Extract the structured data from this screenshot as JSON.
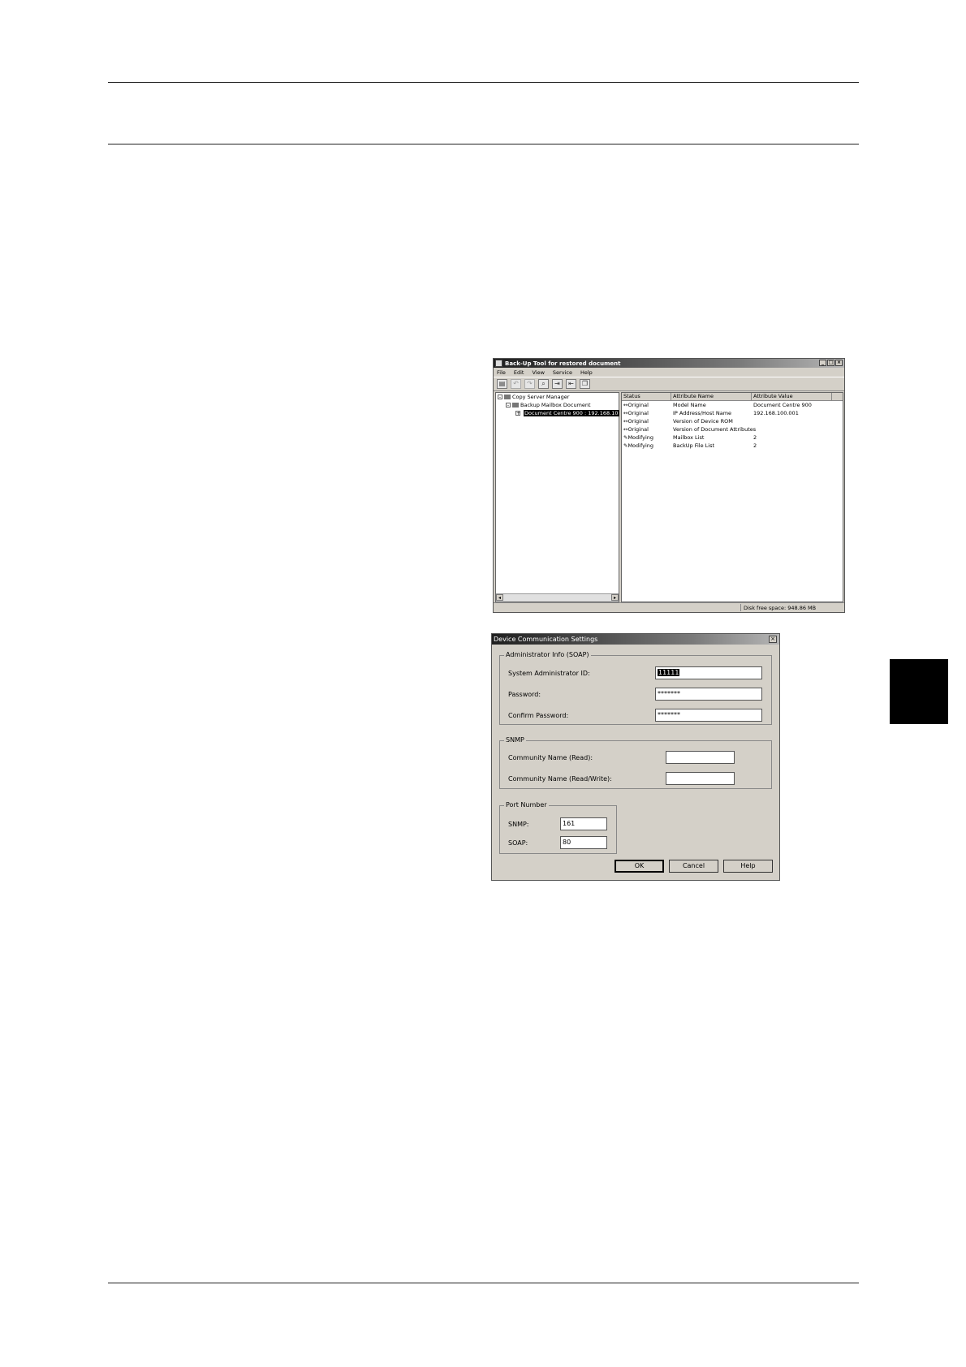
{
  "window1": {
    "title": "Back-Up Tool for restored document",
    "menu": [
      "File",
      "Edit",
      "View",
      "Service",
      "Help"
    ],
    "toolbar_icons": [
      "new-icon",
      "undo-icon",
      "redo-icon",
      "search-icon",
      "export-icon",
      "import-icon",
      "copy-icon"
    ],
    "tree": [
      {
        "label": "Copy Server Manager",
        "level": 0,
        "expander": "⊟"
      },
      {
        "label": "Backup Mailbox Document",
        "level": 1,
        "expander": "⊟"
      },
      {
        "label": "Document Centre 900 : 192.168.10",
        "level": 2,
        "expander": "⊞",
        "selected": true
      }
    ],
    "columns": [
      "Status",
      "Attribute Name",
      "Attribute Value"
    ],
    "rows": [
      {
        "status": "Original",
        "name": "Model Name",
        "value": "Document Centre 900"
      },
      {
        "status": "Original",
        "name": "IP Address/Host Name",
        "value": "192.168.100.001"
      },
      {
        "status": "Original",
        "name": "Version of Device ROM",
        "value": ""
      },
      {
        "status": "Original",
        "name": "Version of Document Attributes",
        "value": ""
      },
      {
        "status": "Modifying",
        "name": "Mailbox List",
        "value": "2"
      },
      {
        "status": "Modifying",
        "name": "BackUp File List",
        "value": "2"
      }
    ],
    "status_text": "Disk free space: 948.86 MB"
  },
  "window2": {
    "title": "Device Communication Settings",
    "admin_group": "Administrator Info (SOAP)",
    "admin_id_label": "System Administrator ID:",
    "admin_id_value": "11111",
    "password_label": "Password:",
    "password_value": "*******",
    "confirm_label": "Confirm Password:",
    "confirm_value": "*******",
    "snmp_group": "SNMP",
    "community_read_label": "Community Name (Read):",
    "community_read_value": "",
    "community_rw_label": "Community Name (Read/Write):",
    "community_rw_value": "",
    "port_group": "Port Number",
    "snmp_port_label": "SNMP:",
    "snmp_port_value": "161",
    "soap_port_label": "SOAP:",
    "soap_port_value": "80",
    "ok_label": "OK",
    "cancel_label": "Cancel",
    "help_label": "Help"
  }
}
